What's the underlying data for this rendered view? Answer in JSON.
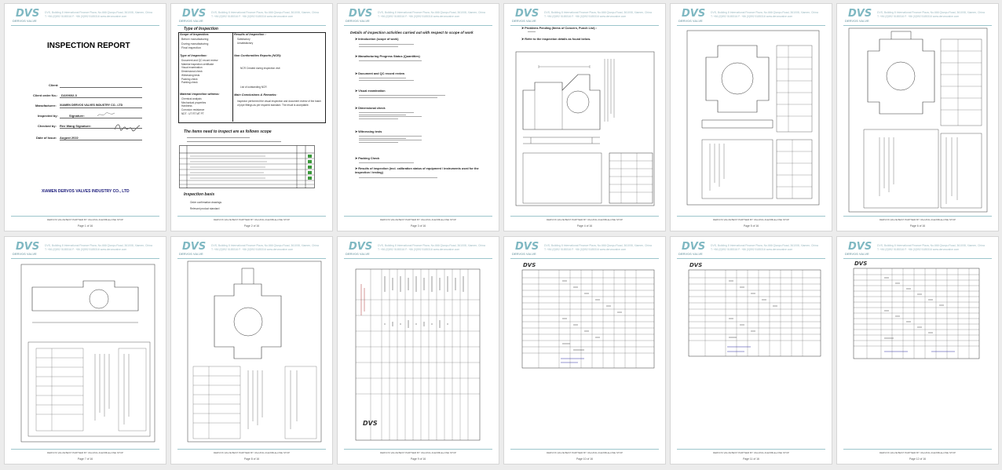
{
  "document": {
    "header": {
      "logo": "DVS",
      "logo_sub": "DERVOS VALVE",
      "address_line1": "DVS, Building 8 International Finance Plaza, No.666 Qianpu Road, 361008, Xiamen, China",
      "address_line2": "T: +86 (0)592 5185316   F: +86 (0)592 5185316   www.dervosvalve.com"
    },
    "footer_text": "DERVOS VALVE BEST PARTNER BY VALUING-FLEXIBLE+ONE STOP"
  },
  "cover": {
    "title": "INSPECTION REPORT",
    "fields": [
      {
        "label": "Client:",
        "value": ""
      },
      {
        "label": "Client order No.:",
        "value": "D220602-3"
      },
      {
        "label": "Manufacturer:",
        "value": "XIAMEN DERVOS VALVES INDUSTRY CO., LTD"
      },
      {
        "label": "Inspected by:",
        "value": "Signature:"
      },
      {
        "label": "Checked by:",
        "value": "Rex Wang      Signature:"
      },
      {
        "label": "Date of Issue:",
        "value": "August   2022"
      }
    ],
    "company": "XIAMEN DERVOS VALVES INDUSTRY CO., LTD"
  },
  "page2": {
    "type_heading": "Type of Inspection",
    "scope_heading": "Scope of Inspection:",
    "scope_items": [
      "Before manufacturing",
      "During manufacturing",
      "Final inspection"
    ],
    "result_heading": "Results of Inspection :",
    "result_items": [
      "Satisfactory",
      "Unsatisfactory"
    ],
    "type_heading2": "Type of Inspection:",
    "type_items": [
      "Document and QC record review",
      "Material inspection certificate",
      "Visual examination",
      "Dimensional check",
      "Witnessing tests",
      "Packing check",
      "Painting check"
    ],
    "ncr_heading": "Non Conformities Reports (NCR):",
    "ncr_items": [
      "NCR   Created during inspection visit",
      "List of outstanding NCR"
    ],
    "witness_heading": "Material inspection witness:",
    "witness_items": [
      "Chemical analysis",
      "Mechanical properties",
      "Hardness",
      "Corrosion resistance",
      "NDT : UT  RT  MT  PT"
    ],
    "conclusions_heading": "Main Conclusions & Remarks:",
    "conclusions_text": "Inspector performed the visual inspection and document review of the batch of pipe fittings as per required standard. The result is acceptable.",
    "scope_title": "The items need to inspect are as follows scope",
    "basis_heading": "Inspection basis",
    "basis_items": [
      "Order confirmation drawings",
      "Relevant product standard"
    ]
  },
  "page3": {
    "heading": "Details of inspection activities carried out with respect to scope of work",
    "sections": [
      "Introduction (scope of work)",
      "Manufacturing Progress Status (Quantities)",
      "Document and QC record review",
      "Visual examination",
      "Dimensional check",
      "Witnessing tests",
      "Packing Check",
      "Results of inspection (incl. calibration status of equipment / instruments used for the inspection / testing)"
    ]
  },
  "page4": {
    "items": [
      "Problems Pending (Items of Concern, Punch List) :",
      "Refer to the inspection details as found below."
    ]
  },
  "pages": [
    {
      "label": "Page 1 of 16"
    },
    {
      "label": "Page 2 of 16"
    },
    {
      "label": "Page 3 of 16"
    },
    {
      "label": "Page 4 of 16"
    },
    {
      "label": "Page 5 of 16"
    },
    {
      "label": "Page 6 of 16"
    },
    {
      "label": "Page 7 of 16"
    },
    {
      "label": "Page 8 of 16"
    },
    {
      "label": "Page 9 of 16"
    },
    {
      "label": "Page 10 of 16"
    },
    {
      "label": "Page 11 of 16"
    },
    {
      "label": "Page 12 of 16"
    }
  ]
}
